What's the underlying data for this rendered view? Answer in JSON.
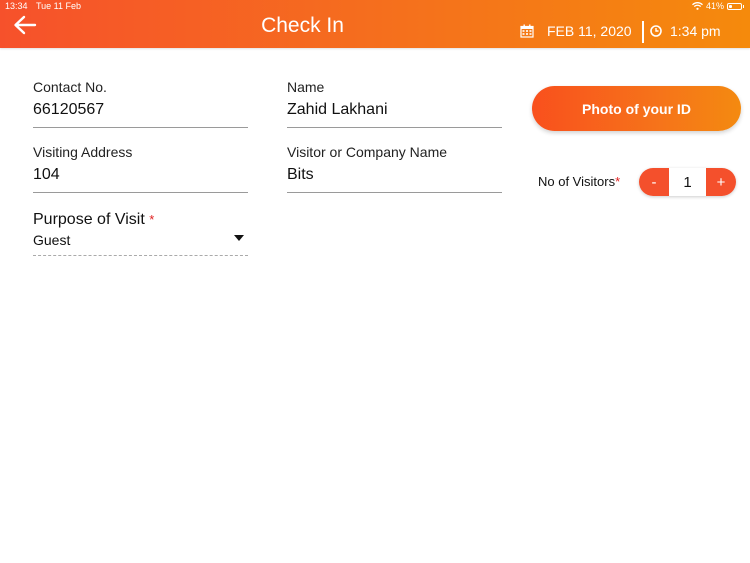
{
  "status_bar": {
    "time": "13:34",
    "date": "Tue 11 Feb",
    "battery_percent": "41%",
    "battery_level": 0.41,
    "wifi_icon": "wifi-icon",
    "battery_icon": "battery-icon"
  },
  "header": {
    "back_icon": "arrow-left-icon",
    "title": "Check In",
    "calendar_icon": "calendar-icon",
    "date": "FEB 11, 2020",
    "clock_icon": "clock-icon",
    "time": "1:34 pm",
    "gradient_start": "#f6512b",
    "gradient_end": "#f58a0c"
  },
  "form": {
    "contact_no": {
      "label": "Contact No.",
      "value": "66120567"
    },
    "name": {
      "label": "Name",
      "value": "Zahid Lakhani"
    },
    "visiting_address": {
      "label": "Visiting Address",
      "value": "104"
    },
    "visitor_company": {
      "label": "Visitor or Company Name",
      "value": "Bits"
    },
    "purpose": {
      "label": "Purpose of Visit",
      "required_mark": "*",
      "value": "Guest",
      "dropdown_icon": "caret-down-icon"
    }
  },
  "photo_button": {
    "label": "Photo of your ID"
  },
  "visitors": {
    "label": "No of Visitors",
    "required_mark": "*",
    "minus_label": "-",
    "value": "1",
    "plus_label": "+"
  },
  "colors": {
    "accent": "#f4502c",
    "required": "#e02020"
  }
}
